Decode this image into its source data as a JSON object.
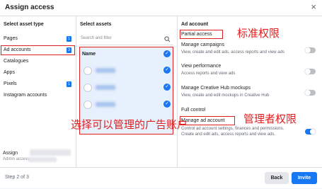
{
  "dialog": {
    "title": "Assign access",
    "close_glyph": "×"
  },
  "asset_types": {
    "heading": "Select asset type",
    "items": [
      {
        "label": "Pages",
        "badge": "1"
      },
      {
        "label": "Ad accounts",
        "badge": "3"
      },
      {
        "label": "Catalogues",
        "badge": ""
      },
      {
        "label": "Apps",
        "badge": ""
      },
      {
        "label": "Pixels",
        "badge": "1"
      },
      {
        "label": "Instagram accounts",
        "badge": ""
      }
    ],
    "assign_label": "Assign",
    "assign_sub": "Admin access"
  },
  "assets": {
    "heading": "Select assets",
    "search_placeholder": "Search and filter",
    "name_header": "Name",
    "check_glyph": "✓",
    "rows": 3
  },
  "ad_account": {
    "heading": "Ad account",
    "partial_access": "Partial access",
    "manage_campaigns": {
      "title": "Manage campaigns",
      "desc": "View, create and edit ads, access reports and view ads"
    },
    "view_performance": {
      "title": "View performance",
      "desc": "Access reports and view ads"
    },
    "creative_hub": {
      "title": "Manage Creative Hub mockups",
      "desc": "View, create and edit mockups in Creative Hub"
    },
    "full_control": "Full control",
    "manage_ad_account": {
      "title": "Manage ad account",
      "desc": "Control ad account settings, finances and permissions. Create and edit ads, access reports and view ads."
    }
  },
  "annotations": {
    "partial": "标准权限",
    "admin": "管理者权限",
    "select": "选择可以管理的广告账户"
  },
  "footer": {
    "step": "Step 2 of 3",
    "back": "Back",
    "invite": "Invite"
  },
  "colors": {
    "accent": "#1877f2",
    "annotation_red": "#e02020"
  }
}
